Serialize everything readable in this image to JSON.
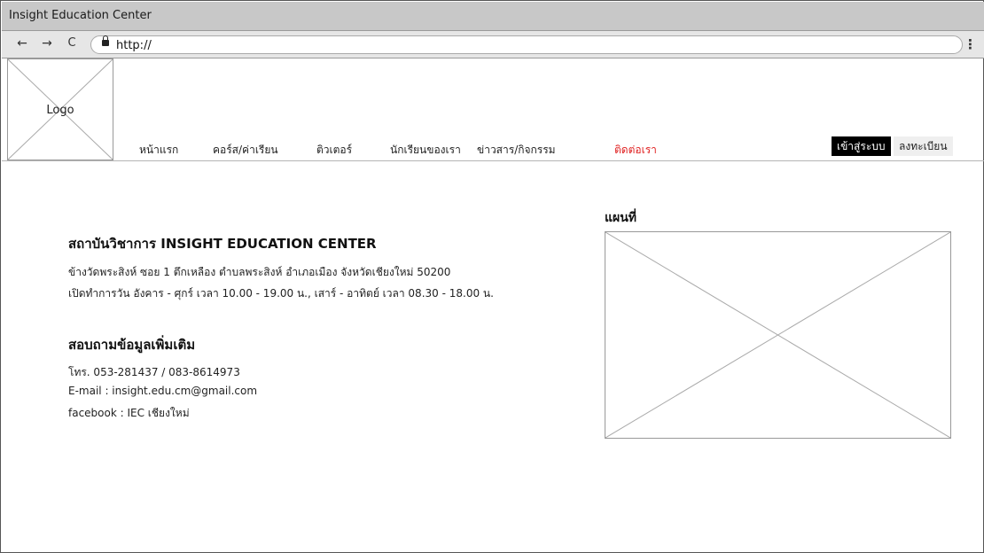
{
  "browser": {
    "window_title": "Insight Education Center",
    "url": "http://",
    "back_icon": "←",
    "forward_icon": "→",
    "reload_icon": "C",
    "menu_icon": "⋮"
  },
  "header": {
    "logo_label": "Logo",
    "nav": [
      {
        "label": "หน้าแรก"
      },
      {
        "label": "คอร์ส/ค่าเรียน"
      },
      {
        "label": "ติวเตอร์"
      },
      {
        "label": "นักเรียนของเรา"
      },
      {
        "label": "ข่าวสาร/กิจกรรม"
      },
      {
        "label": "ติดต่อเรา"
      }
    ],
    "active_nav": "ติดต่อเรา",
    "login_label": "เข้าสู่ระบบ",
    "register_label": "ลงทะเบียน",
    "active_color": "#e02020"
  },
  "contact": {
    "institute_title": "สถาบันวิชาการ INSIGHT EDUCATION CENTER",
    "address": "ข้างวัดพระสิงห์ ซอย 1 ตึกเหลือง ตำบลพระสิงห์ อำเภอเมือง จังหวัดเชียงใหม่ 50200",
    "hours": "เปิดทำการวัน อังคาร - ศุกร์ เวลา 10.00 - 19.00 น., เสาร์ - อาทิตย์ เวลา 08.30 - 18.00 น.",
    "more_info_title": "สอบถามข้อมูลเพิ่มเติม",
    "phone": "โทร. 053-281437 / 083-8614973",
    "email": "E-mail :  insight.edu.cm@gmail.com",
    "facebook": "facebook :  IEC เชียงใหม่"
  },
  "map": {
    "title": "แผนที่"
  }
}
